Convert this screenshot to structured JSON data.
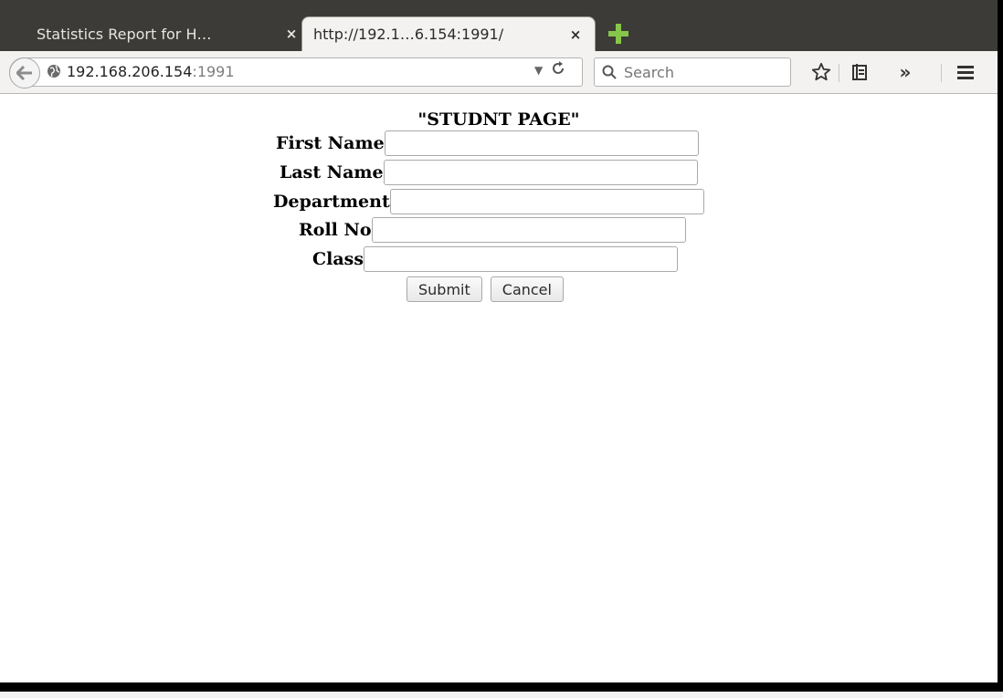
{
  "browser": {
    "tabs": [
      {
        "title": "Statistics Report for H…",
        "close": "×",
        "active": false
      },
      {
        "title": "http://192.1…6.154:1991/",
        "close": "×",
        "active": true
      }
    ],
    "new_tab_icon": "plus-icon",
    "url": {
      "host": "192.168.206.154",
      "port": ":1991"
    },
    "search_placeholder": "Search",
    "toolbar_icons": [
      "star-icon",
      "reading-list-icon",
      "overflow-chevron-icon",
      "hamburger-menu-icon"
    ]
  },
  "page": {
    "heading": "\"STUDNT PAGE\"",
    "fields": [
      {
        "label": "First Name",
        "value": ""
      },
      {
        "label": "Last Name",
        "value": ""
      },
      {
        "label": "Department",
        "value": ""
      },
      {
        "label": "Roll No",
        "value": ""
      },
      {
        "label": "Class",
        "value": ""
      }
    ],
    "buttons": {
      "submit": "Submit",
      "cancel": "Cancel"
    }
  },
  "colors": {
    "tabstrip": "#3c3b37",
    "toolbar": "#f3f2f0",
    "new_tab_plus": "#86c64a"
  }
}
